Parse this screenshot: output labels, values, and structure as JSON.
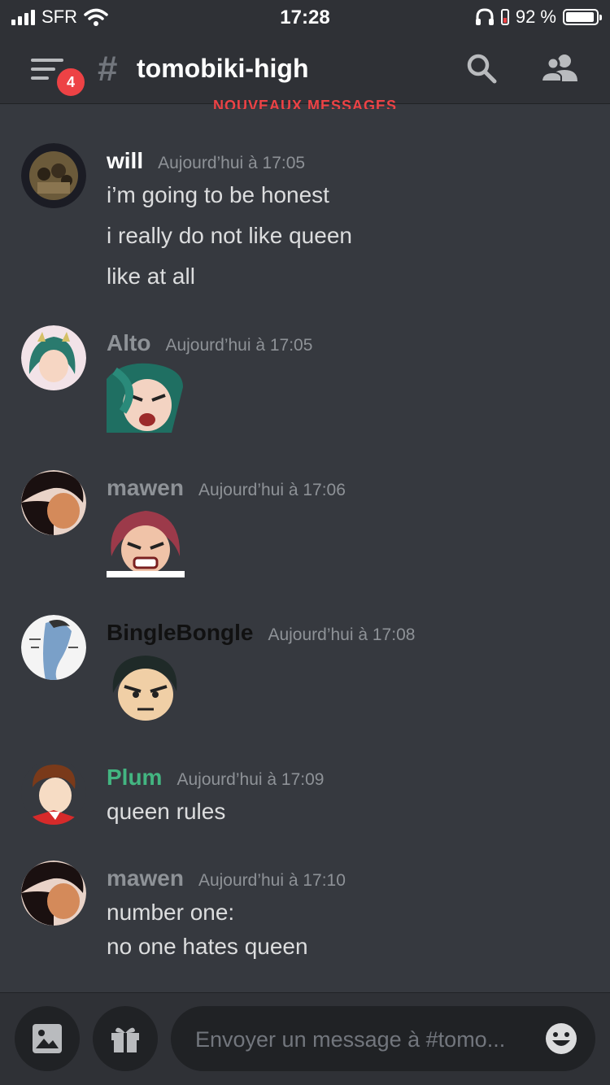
{
  "status": {
    "carrier": "SFR",
    "time": "17:28",
    "battery": "92 %"
  },
  "header": {
    "channel_name": "tomobiki-high",
    "notification_count": "4",
    "channel_hash": "#"
  },
  "separator": {
    "label": "NOUVEAUX MESSAGES"
  },
  "messages": [
    {
      "author": "will",
      "author_color": "#ffffff",
      "timestamp": "Aujourd’hui à 17:05",
      "lines": [
        "i’m going to be honest",
        "i really do not like queen",
        "like at all"
      ]
    },
    {
      "author": "Alto",
      "author_color": "#8e9297",
      "timestamp": "Aujourd’hui à 17:05",
      "sticker": "angry-green-hair-sticker"
    },
    {
      "author": "mawen",
      "author_color": "#8e9297",
      "timestamp": "Aujourd’hui à 17:06",
      "sticker": "angry-pink-hair-sticker"
    },
    {
      "author": "BingleBongle",
      "author_color": "#111111",
      "timestamp": "Aujourd’hui à 17:08",
      "sticker": "angry-dark-hair-sticker"
    },
    {
      "author": "Plum",
      "author_color": "#43b581",
      "timestamp": "Aujourd’hui à 17:09",
      "lines": [
        "queen rules"
      ]
    },
    {
      "author": "mawen",
      "author_color": "#8e9297",
      "timestamp": "Aujourd’hui à 17:10",
      "lines": [
        "number one:",
        "no one hates queen"
      ]
    }
  ],
  "composer": {
    "placeholder": "Envoyer un message à #tomo..."
  },
  "colors": {
    "background": "#36393f",
    "header": "#2f3136",
    "input": "#202225",
    "accent_red": "#ed4245"
  }
}
